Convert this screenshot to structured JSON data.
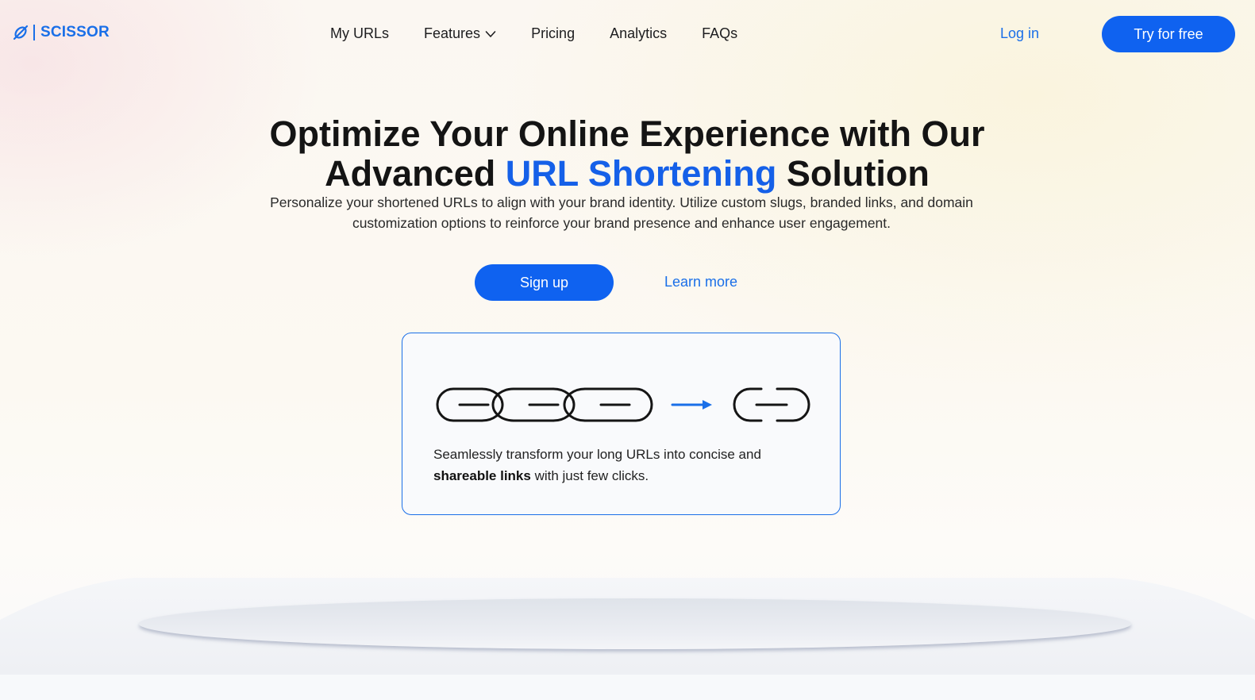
{
  "brand": {
    "name": "SCISSOR",
    "accent_color": "#0f62f0",
    "logo_icon": "scissor-link-icon"
  },
  "nav": {
    "items": [
      {
        "label": "My URLs"
      },
      {
        "label": "Features",
        "icon": "chevron-down-icon"
      },
      {
        "label": "Pricing"
      },
      {
        "label": "Analytics"
      },
      {
        "label": "FAQs"
      }
    ]
  },
  "header": {
    "login_label": "Log in",
    "cta_label": "Try for free"
  },
  "hero": {
    "title_line1": "Optimize Your Online Experience with Our",
    "title_line2_before": "Advanced ",
    "title_line2_highlight": "URL Shortening",
    "title_line2_after": " Solution",
    "subtitle": "Personalize your shortened URLs to align with your brand identity. Utilize custom slugs, branded links, and domain customization options to reinforce your brand presence and enhance user engagement.",
    "signup_label": "Sign up",
    "learn_more_label": "Learn more"
  },
  "card": {
    "illustration": "long-chain-to-short-link-icon",
    "text_start": "Seamlessly transform your long URLs into concise and ",
    "text_bold": "shareable links",
    "text_end": " with just few clicks."
  }
}
